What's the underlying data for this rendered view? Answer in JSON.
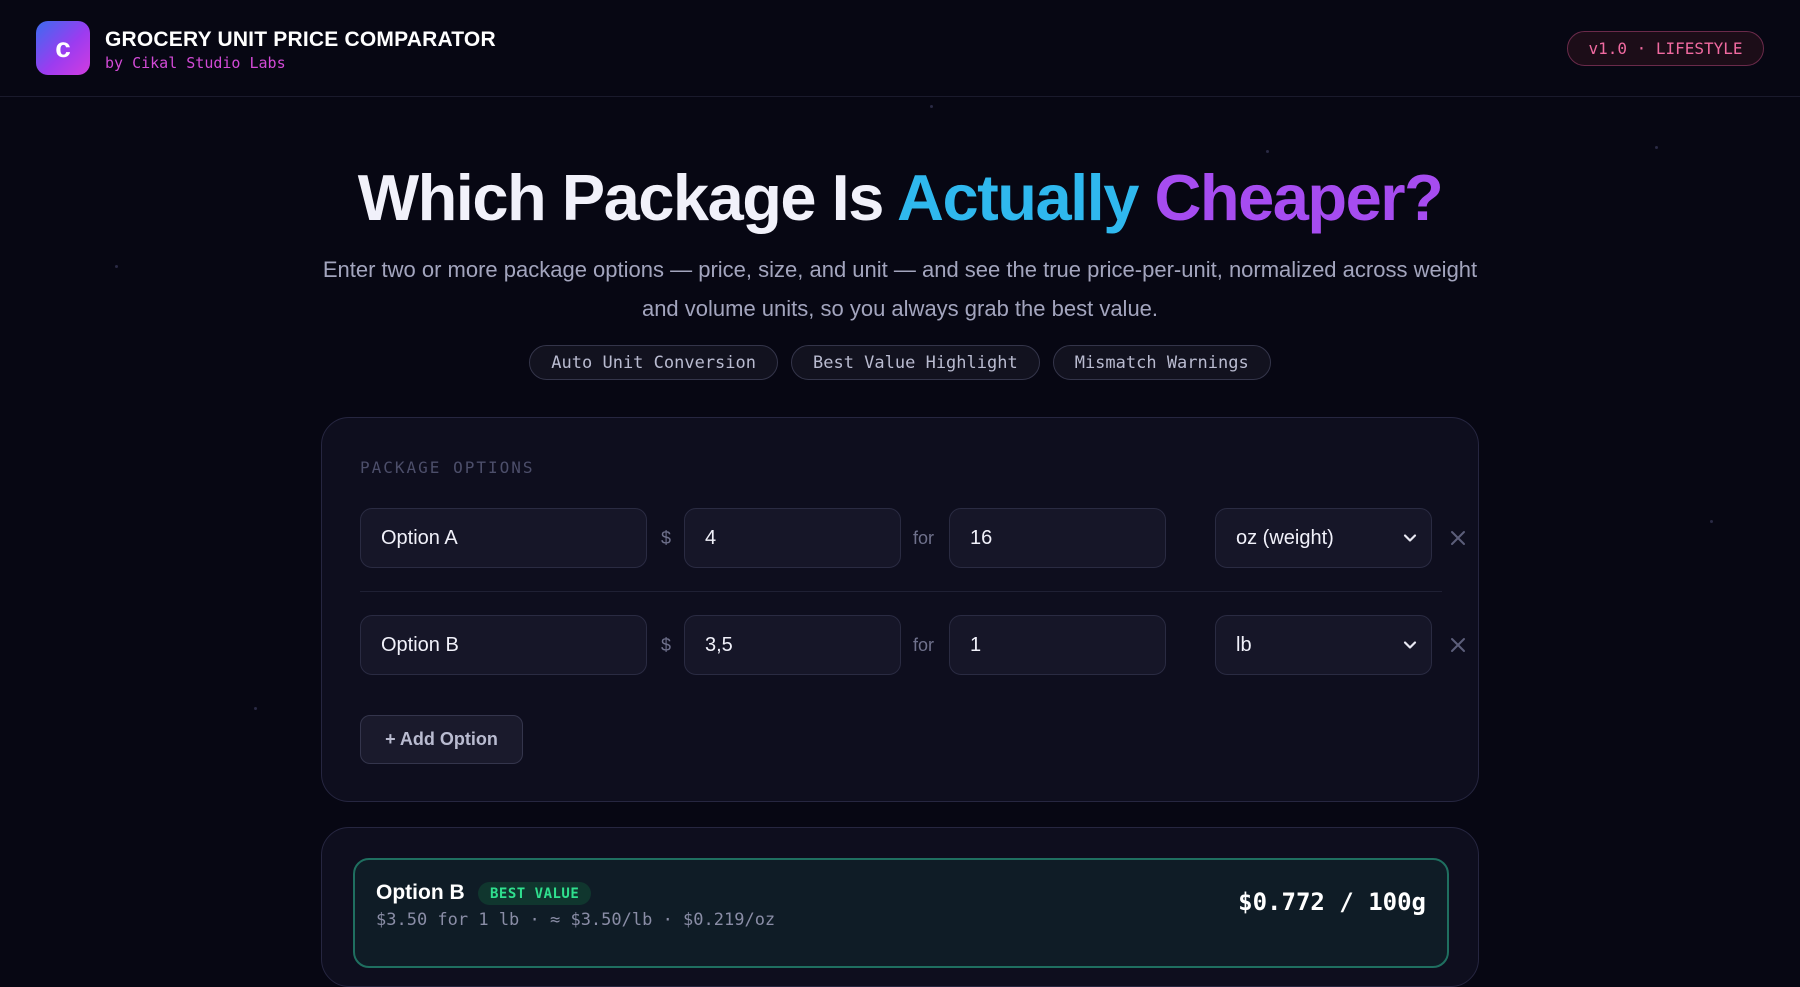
{
  "header": {
    "logo_letter": "c",
    "title": "GROCERY UNIT PRICE COMPARATOR",
    "subtitle": "by Cikal Studio Labs",
    "version_badge": "v1.0 · LIFESTYLE"
  },
  "hero": {
    "title_part1": "Which Package Is ",
    "title_part2": "Actually",
    "title_part3": "Cheaper?",
    "subtitle": "Enter two or more package options — price, size, and unit — and see the true price-per-unit, normalized across weight and volume units, so you always grab the best value.",
    "chips": [
      "Auto Unit Conversion",
      "Best Value Highlight",
      "Mismatch Warnings"
    ]
  },
  "options_card": {
    "section_label": "PACKAGE OPTIONS",
    "currency_symbol": "$",
    "for_label": "for",
    "rows": [
      {
        "name": "Option A",
        "price": "4",
        "size": "16",
        "unit": "oz (weight)"
      },
      {
        "name": "Option B",
        "price": "3,5",
        "size": "1",
        "unit": "lb"
      }
    ],
    "add_button": "+ Add Option"
  },
  "results": {
    "best": {
      "name": "Option B",
      "badge": "BEST VALUE",
      "detail": "$3.50 for 1 lb · ≈ $3.50/lb · $0.219/oz",
      "normalized_price": "$0.772 / 100g"
    }
  },
  "colors": {
    "accent_cyan": "#2fb8ee",
    "accent_purple": "#a64cf0",
    "best_value_green": "#2fe08e",
    "badge_pink": "#f06aa0"
  }
}
